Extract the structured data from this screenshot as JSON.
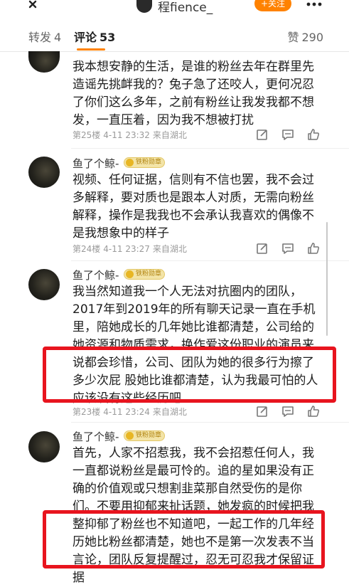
{
  "header": {
    "title": "程fience_",
    "follow_label": "+关注"
  },
  "tabs": {
    "repost_label": "转发",
    "repost_count": "4",
    "comments_label": "评论",
    "comments_count": "53",
    "likes_label": "赞",
    "likes_count": "290"
  },
  "comments": [
    {
      "text": "我本想安静的生活，是谁的粉丝去年在群里先造谣先挑衅我的？兔子急了还咬人，更何况忍了你们这么多年，之前有粉丝让我发我都不想发，一直压着，因为我不想被打扰",
      "floor": "第25楼",
      "time": "4-11 23:32",
      "location": "来自湖北"
    },
    {
      "username": "鱼了个鲸-",
      "badge": "铁粉勋章",
      "text": "视频、任何证据，信则有不信也罢，我不会过多解释，要对质也是跟本人对质，无需向粉丝解释，操作是我我也不会承认我喜欢的偶像不是我想象中的样子",
      "floor": "第24楼",
      "time": "4-11 23:27",
      "location": "来自湖北"
    },
    {
      "username": "鱼了个鲸-",
      "badge": "铁粉勋章",
      "text": "我当然知道我一个人无法对抗圈内的团队，2017年到2019年的所有聊天记录一直在手机里，陪她成长的几年她比谁都清楚，公司给的她资源和物质需求，换作爱这份职业的演员来说都会珍惜，公司、团队为她的很多行为擦了多少次屁 股她比谁都清楚，认为我最可怕的人应该没有这些经历吧",
      "floor": "第23楼",
      "time": "4-11 23:24",
      "location": "来自湖北"
    },
    {
      "username": "鱼了个鲸-",
      "badge": "铁粉勋章",
      "text": "首先，人家不招惹我，我不会招惹任何人，我一直都说粉丝是最可怜的。追的星如果没有正确的价值观或只想割韭菜那自然受伤的是你们。不要用抑郁来扯话题，她发疯的时候把我整抑郁了粉丝也不知道吧，一起工作的几年经历她比粉丝都清楚，她也不是第一次发表不当言论，团队反复提醒过，忍无可忍我才保留证据"
    }
  ],
  "icons": {
    "back": "chevron-left-icon",
    "more": "more-dots-icon",
    "reply": "reply-icon",
    "comment": "comment-icon",
    "like": "thumbs-up-icon",
    "badge": "fan-badge-icon"
  },
  "colors": {
    "accent": "#ff8200",
    "highlight_box": "#e8141e",
    "badge_bg": "#f3e4a8"
  }
}
